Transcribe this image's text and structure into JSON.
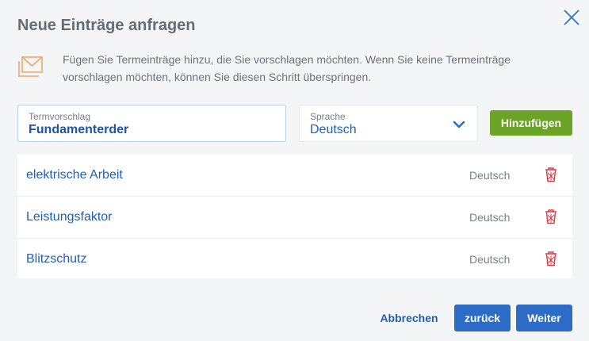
{
  "dialog": {
    "title": "Neue Einträge anfragen",
    "intro": "Fügen Sie Termeinträge hinzu, die Sie vorschlagen möchten. Wenn Sie keine Termeinträge vorschlagen möchten, können Sie diesen Schritt überspringen."
  },
  "form": {
    "term_label": "Termvorschlag",
    "term_value": "Fundamenterder",
    "language_label": "Sprache",
    "language_value": "Deutsch",
    "add_label": "Hinzufügen"
  },
  "entries": [
    {
      "term": "elektrische Arbeit",
      "language": "Deutsch"
    },
    {
      "term": "Leistungsfaktor",
      "language": "Deutsch"
    },
    {
      "term": "Blitzschutz",
      "language": "Deutsch"
    }
  ],
  "footer": {
    "cancel_label": "Abbrechen",
    "back_label": "zurück",
    "next_label": "Weiter"
  },
  "icons": {
    "close": "close-icon",
    "intro": "mail-stack-icon",
    "dropdown": "chevron-down-icon",
    "delete": "trash-icon"
  },
  "colors": {
    "accent": "#2c6bc6",
    "add": "#6aa326",
    "delete": "#e0383e",
    "link": "#1f5fb8"
  }
}
